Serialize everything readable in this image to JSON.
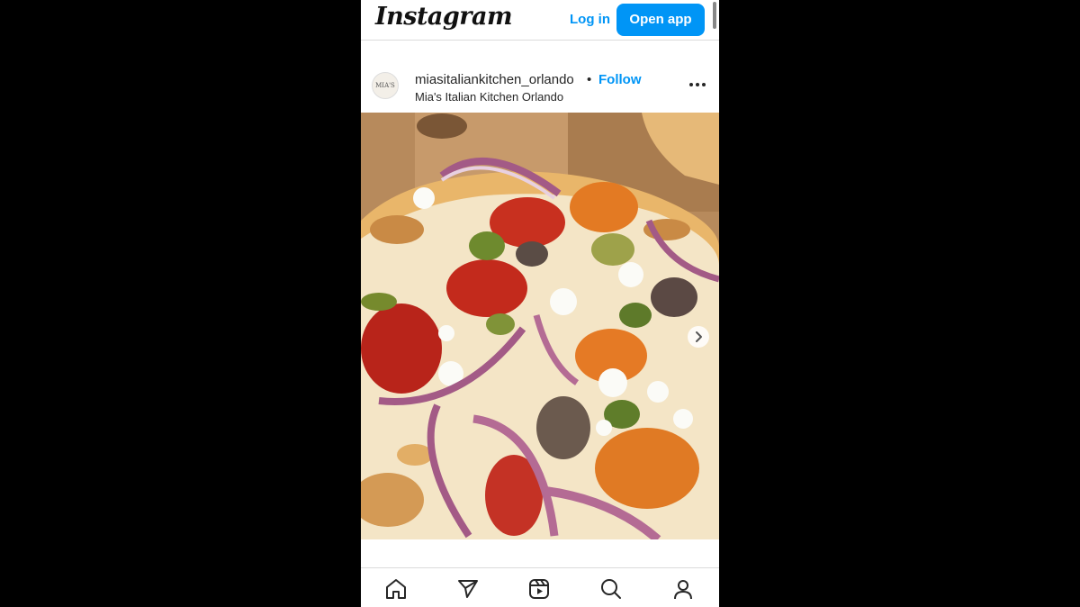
{
  "header": {
    "logo": "Instagram",
    "login_label": "Log in",
    "open_app_label": "Open app",
    "accent": "#0095f6"
  },
  "post": {
    "avatar_text": "MIA'S",
    "username": "miasitaliankitchen_orlando",
    "separator": "•",
    "follow_label": "Follow",
    "location": "Mia's Italian Kitchen Orlando",
    "more_icon": "more-horizontal-icon",
    "photo_subject": "pizza",
    "next_icon": "chevron-right-icon"
  },
  "nav": {
    "icons": [
      "home-icon",
      "direct-send-icon",
      "reels-icon",
      "search-icon",
      "profile-icon"
    ]
  }
}
